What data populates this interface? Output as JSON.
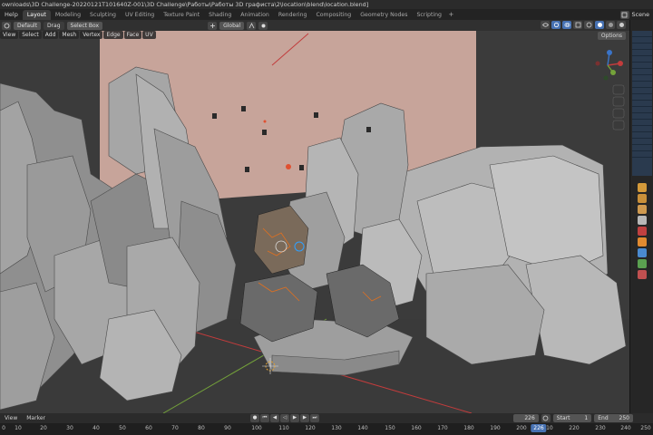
{
  "window": {
    "path": "ownloads\\3D Challenge-20220121T101640Z-001\\3D Challenge\\Работы\\Работы 3D графиста\\2\\location\\blend\\location.blend]"
  },
  "menubar": {
    "help": "Help",
    "workspaces": [
      "Layout",
      "Modeling",
      "Sculpting",
      "UV Editing",
      "Texture Paint",
      "Shading",
      "Animation",
      "Rendering",
      "Compositing",
      "Geometry Nodes",
      "Scripting"
    ],
    "add_tab": "+",
    "scene_label": "Scene"
  },
  "viewport_header": {
    "orientation": "Default",
    "drag_label": "Drag",
    "drag_value": "Select Box",
    "transform": "Global",
    "options": "Options"
  },
  "viewport_menu": [
    "View",
    "Select",
    "Add",
    "Mesh",
    "Vertex",
    "Edge",
    "Face",
    "UV"
  ],
  "timeline": {
    "view": "View",
    "marker": "Marker",
    "current_frame": "226",
    "start_label": "Start",
    "start": "1",
    "end_label": "End",
    "end": "250",
    "ticks": [
      "0",
      "10",
      "20",
      "30",
      "40",
      "50",
      "60",
      "70",
      "80",
      "90",
      "100",
      "110",
      "120",
      "130",
      "140",
      "150",
      "160",
      "170",
      "180",
      "190",
      "200",
      "210",
      "220",
      "226",
      "230",
      "240",
      "250"
    ]
  },
  "colors": {
    "accent": "#4772b3",
    "background_wall": "#c7a49a",
    "rock": "#9c9c9c",
    "floor": "#3b3b3b",
    "x_axis": "#c23c3c",
    "y_axis": "#74a23a"
  },
  "icons": {
    "gizmo": "navigation-gizmo",
    "cursor": "3d-cursor"
  }
}
